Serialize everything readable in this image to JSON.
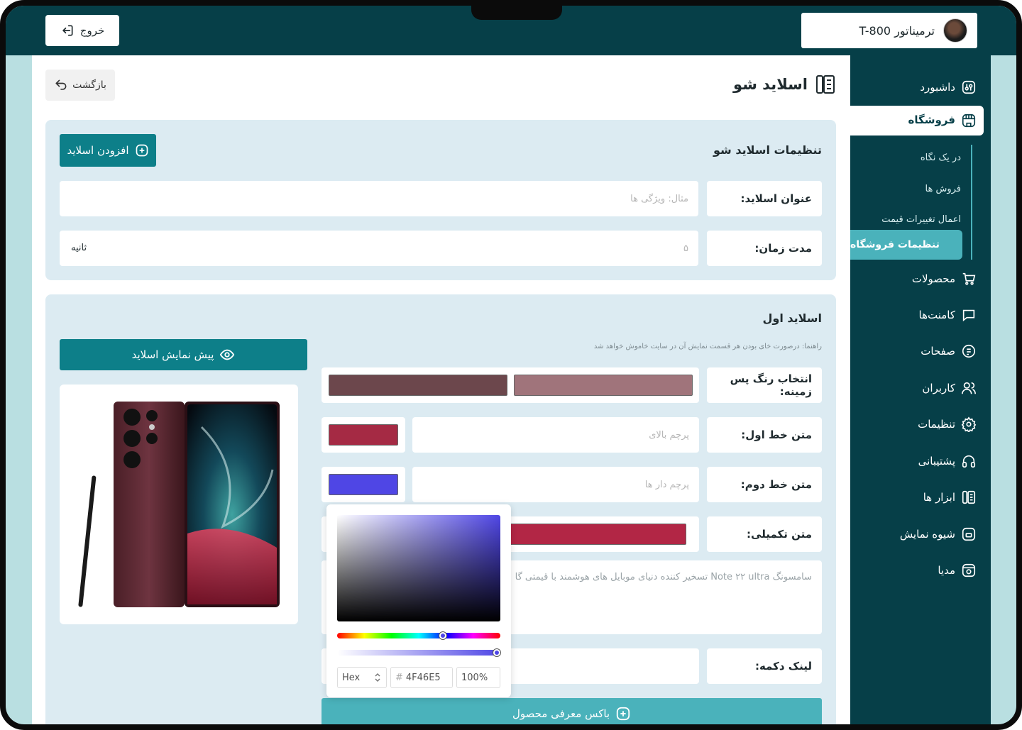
{
  "topbar": {
    "exit_label": "خروج",
    "user_name": "ترميناتور T-800"
  },
  "sidebar": {
    "items": [
      {
        "label": "داشبورد",
        "icon": "dashboard-icon"
      },
      {
        "label": "فروشگاه",
        "icon": "store-icon"
      },
      {
        "label": "محصولات",
        "icon": "cart-icon"
      },
      {
        "label": "کامنت‌ها",
        "icon": "comment-icon"
      },
      {
        "label": "صفحات",
        "icon": "pages-icon"
      },
      {
        "label": "کاربران",
        "icon": "users-icon"
      },
      {
        "label": "تنظیمات",
        "icon": "gear-icon"
      },
      {
        "label": "پشتیبانی",
        "icon": "headset-icon"
      },
      {
        "label": "ابزار ها",
        "icon": "tools-icon"
      },
      {
        "label": "شیوه نمایش",
        "icon": "display-icon"
      },
      {
        "label": "مدیا",
        "icon": "media-icon"
      }
    ],
    "sub_items": [
      "در یک نگاه",
      "فروش ها",
      "اعمال تغییرات قیمت",
      "تنظیمات فروشگاه"
    ]
  },
  "page": {
    "title": "اسلاید شو",
    "back_label": "بازگشت"
  },
  "settings": {
    "title": "تنظیمات اسلاید شو",
    "add_slide_label": "افزودن اسلاید",
    "slide_title_label": "عنوان اسلاید:",
    "slide_title_placeholder": "مثال: ویژگی ها",
    "duration_label": "مدت زمان:",
    "duration_value": "۵",
    "duration_unit": "ثانیه"
  },
  "slide": {
    "title": "اسلاید اول",
    "hint": "راهنما: درصورت خای بودن هر قسمت نمایش آن در سایت خاموش خواهد شد",
    "preview_label": "پیش نمایش اسلاید",
    "bg_color_label": "انتخاب رنگ پس زمینه:",
    "bg_color_1": "#6c474c",
    "bg_color_2": "#a0747b",
    "line1_label": "متن خط اول:",
    "line1_placeholder": "پرچم بالای",
    "line1_color": "#a52a44",
    "line2_label": "متن خط دوم:",
    "line2_placeholder": "پرچم دار ها",
    "line2_color": "#4f46e5",
    "extra_label": "متن تکمیلی:",
    "extra_color": "#b22645",
    "extra_text": "سامسونگ Note ۲۲ ultra تسخیر کننده دنیای موبایل های هوشمند با قیمتی گا",
    "link_label": "لینک دکمه:",
    "product_box_label": "باکس معرفی محصول"
  },
  "color_picker": {
    "mode": "Hex",
    "hex": "4F46E5",
    "alpha": "100%",
    "current_color": "#4f46e5"
  },
  "colors": {
    "brand": "#063f48",
    "accent": "#0d7f89",
    "panel": "#dcebf2",
    "light_teal": "#4ab2bb"
  }
}
